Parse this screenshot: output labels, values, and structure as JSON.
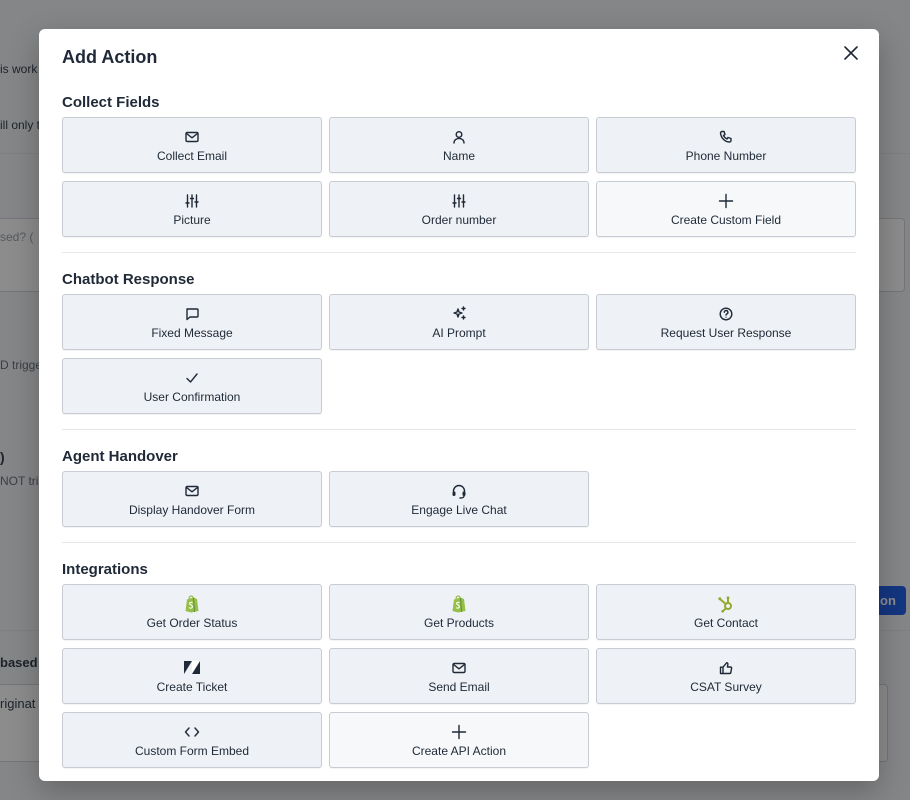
{
  "background": {
    "fragments": [
      "is work",
      "ill only t",
      "sed? (",
      "D trigge",
      ")",
      "NOT trig",
      "based",
      "riginat",
      "on"
    ]
  },
  "modal": {
    "title": "Add Action",
    "sections": [
      {
        "title": "Collect Fields",
        "items": [
          {
            "label": "Collect Email",
            "icon": "mail-icon"
          },
          {
            "label": "Name",
            "icon": "user-icon"
          },
          {
            "label": "Phone Number",
            "icon": "phone-icon"
          },
          {
            "label": "Picture",
            "icon": "sliders-icon"
          },
          {
            "label": "Order number",
            "icon": "sliders-icon"
          },
          {
            "label": "Create Custom Field",
            "icon": "plus-icon"
          }
        ]
      },
      {
        "title": "Chatbot Response",
        "items": [
          {
            "label": "Fixed Message",
            "icon": "message-icon"
          },
          {
            "label": "AI Prompt",
            "icon": "sparkles-icon"
          },
          {
            "label": "Request User Response",
            "icon": "help-circle-icon"
          },
          {
            "label": "User Confirmation",
            "icon": "check-icon"
          }
        ]
      },
      {
        "title": "Agent Handover",
        "items": [
          {
            "label": "Display Handover Form",
            "icon": "mail-icon"
          },
          {
            "label": "Engage Live Chat",
            "icon": "headset-icon"
          }
        ]
      },
      {
        "title": "Integrations",
        "items": [
          {
            "label": "Get Order Status",
            "icon": "shopify-icon"
          },
          {
            "label": "Get Products",
            "icon": "shopify-icon"
          },
          {
            "label": "Get Contact",
            "icon": "hubspot-icon"
          },
          {
            "label": "Create Ticket",
            "icon": "zendesk-icon"
          },
          {
            "label": "Send Email",
            "icon": "mail-icon"
          },
          {
            "label": "CSAT Survey",
            "icon": "thumbs-up-icon"
          },
          {
            "label": "Custom Form Embed",
            "icon": "code-icon"
          },
          {
            "label": "Create API Action",
            "icon": "plus-icon"
          }
        ]
      }
    ]
  },
  "colors": {
    "shopify": "#95bf47",
    "hubspot": "#95a82f",
    "accent": "#2563eb"
  }
}
